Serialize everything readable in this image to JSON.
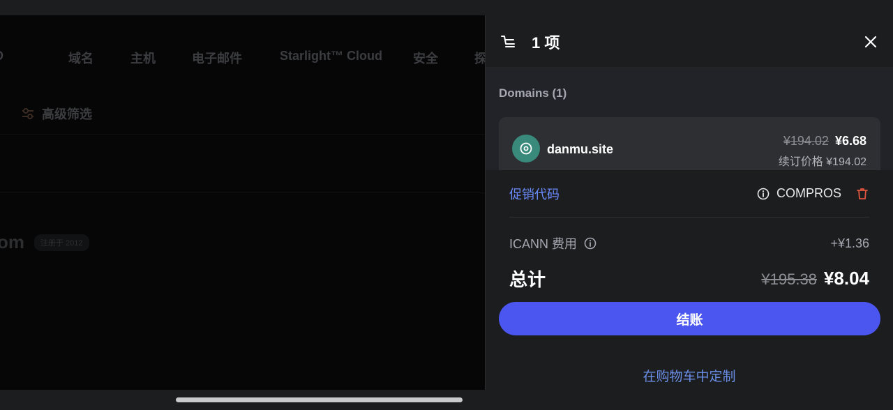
{
  "background": {
    "nav_clipped": "D",
    "nav_items": [
      "域名",
      "主机",
      "电子邮件",
      "Starlight™ Cloud",
      "安全",
      "探"
    ],
    "filter_label": "高级筛选",
    "domain_fragment": "om",
    "domain_badge": "注册于 2012"
  },
  "cart": {
    "title": "1 项",
    "section_label": "Domains (1)",
    "item": {
      "domain": "danmu.site",
      "original_price": "¥194.02",
      "price": "¥6.68",
      "renewal": "续订价格 ¥194.02"
    },
    "promo_link": "促销代码",
    "promo_code": "COMPROS",
    "fee_label": "ICANN 费用",
    "fee_value": "+¥1.36",
    "total_label": "总计",
    "total_original": "¥195.38",
    "total": "¥8.04",
    "checkout_label": "结账",
    "customize_label": "在购物车中定制"
  },
  "colors": {
    "accent": "#4b55f0",
    "link": "#6b8cff",
    "domain_icon_bg": "#3a8a7c",
    "delete": "#e0553f"
  }
}
